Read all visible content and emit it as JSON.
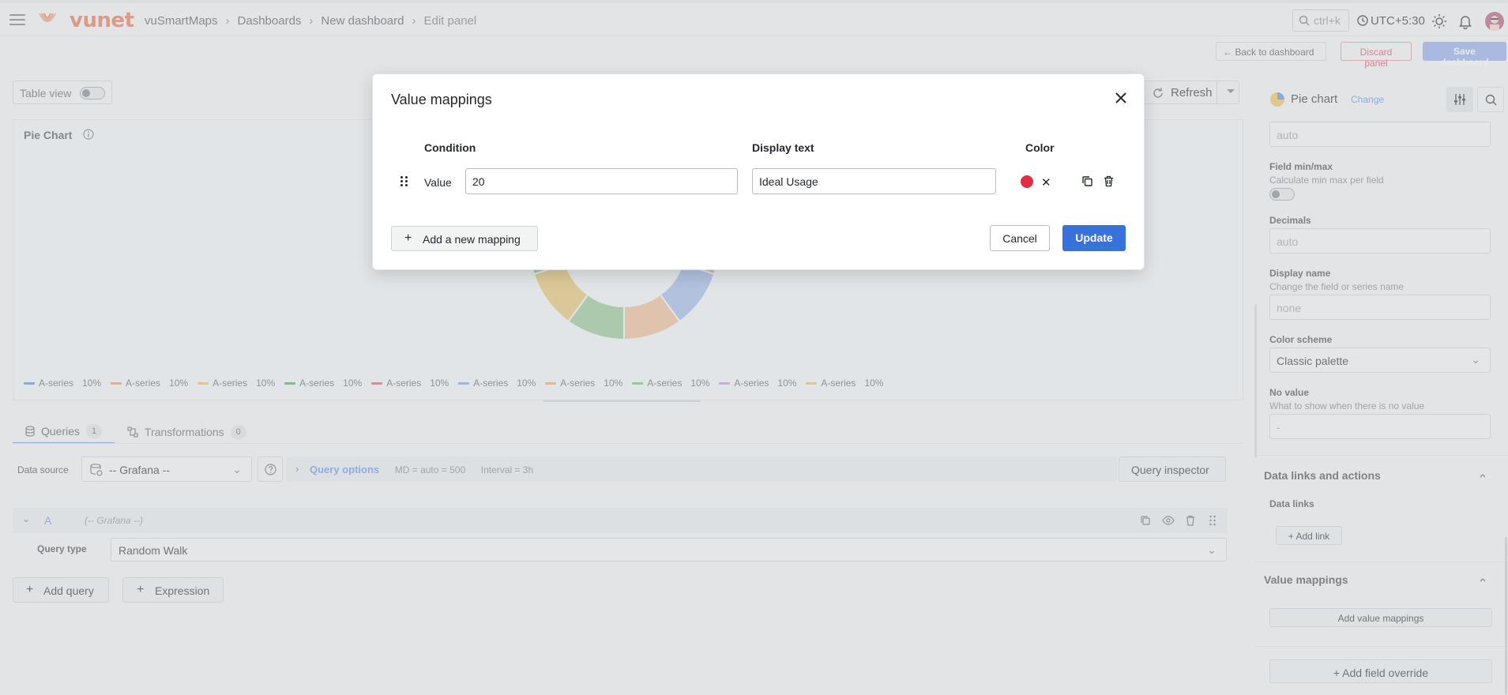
{
  "topbar": {
    "brand": "vunet",
    "breadcrumbs": [
      "vuSmartMaps",
      "Dashboards",
      "New dashboard",
      "Edit panel"
    ],
    "search_placeholder": "ctrl+k",
    "timezone": "UTC+5:30"
  },
  "actions": {
    "back_label": "Back to dashboard",
    "discard_label": "Discard panel",
    "save_label": "Save dashboard"
  },
  "panel": {
    "table_view_label": "Table view",
    "refresh_label": "Refresh",
    "title": "Pie Chart",
    "legend": [
      {
        "name": "A-series",
        "value": "10%",
        "color": "#5f88d9"
      },
      {
        "name": "A-series",
        "value": "10%",
        "color": "#f08a5d"
      },
      {
        "name": "A-series",
        "value": "10%",
        "color": "#f2c14e"
      },
      {
        "name": "A-series",
        "value": "10%",
        "color": "#56a64b"
      },
      {
        "name": "A-series",
        "value": "10%",
        "color": "#e0566b"
      },
      {
        "name": "A-series",
        "value": "10%",
        "color": "#7a9ee0"
      },
      {
        "name": "A-series",
        "value": "10%",
        "color": "#f5a55a"
      },
      {
        "name": "A-series",
        "value": "10%",
        "color": "#73bf69"
      },
      {
        "name": "A-series",
        "value": "10%",
        "color": "#c58fe0"
      },
      {
        "name": "A-series",
        "value": "10%",
        "color": "#f2c14e"
      }
    ]
  },
  "chart_data": {
    "type": "pie",
    "categories": [
      "A-series",
      "A-series",
      "A-series",
      "A-series",
      "A-series",
      "A-series",
      "A-series",
      "A-series",
      "A-series",
      "A-series"
    ],
    "values": [
      10,
      10,
      10,
      10,
      10,
      10,
      10,
      10,
      10,
      10
    ],
    "title": "Pie Chart",
    "colors": [
      "#e7c266",
      "#7fc07a",
      "#e49aa3",
      "#9cb4e6",
      "#f0b98a",
      "#93c48c",
      "#e7c266",
      "#7fc07a",
      "#e49aa3",
      "#9cb4e6"
    ]
  },
  "query_tabs": [
    {
      "label": "Queries",
      "count": "1"
    },
    {
      "label": "Transformations",
      "count": "0"
    }
  ],
  "datasource": {
    "label": "Data source",
    "value": "-- Grafana --",
    "query_options_label": "Query options",
    "md": "MD = auto = 500",
    "interval": "Interval = 3h",
    "inspector_label": "Query inspector"
  },
  "query_a": {
    "letter": "A",
    "ds": "(-- Grafana --)",
    "type_label": "Query type",
    "type_value": "Random Walk"
  },
  "buttons": {
    "add_query": "Add query",
    "expression": "Expression"
  },
  "options": {
    "viz_name": "Pie chart",
    "change_label": "Change",
    "auto_value": "auto",
    "field_minmax_label": "Field min/max",
    "field_minmax_desc": "Calculate min max per field",
    "decimals_label": "Decimals",
    "decimals_placeholder": "auto",
    "display_name_label": "Display name",
    "display_name_desc": "Change the field or series name",
    "display_name_placeholder": "none",
    "color_scheme_label": "Color scheme",
    "color_scheme_value": "Classic palette",
    "no_value_label": "No value",
    "no_value_desc": "What to show when there is no value",
    "no_value_placeholder": "-",
    "data_links_section": "Data links and actions",
    "data_links_label": "Data links",
    "add_link_label": "Add link",
    "value_mappings_section": "Value mappings",
    "add_value_mappings_label": "Add value mappings",
    "add_field_override_label": "Add field override"
  },
  "modal": {
    "title": "Value mappings",
    "col_condition": "Condition",
    "col_display_text": "Display text",
    "col_color": "Color",
    "row": {
      "type": "Value",
      "value": "20",
      "display_text": "Ideal Usage",
      "color": "#e02f44"
    },
    "add_mapping_label": "Add a new mapping",
    "cancel_label": "Cancel",
    "update_label": "Update"
  }
}
